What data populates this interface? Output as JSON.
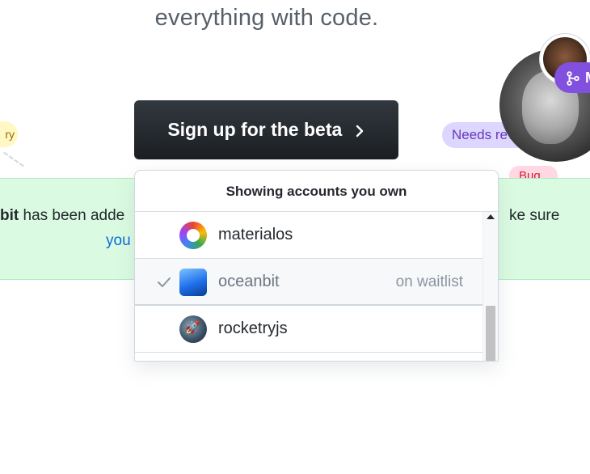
{
  "headline": "everything with code.",
  "labels": {
    "yellow_partial": "ry",
    "needs_review": "Needs review",
    "bug": "Bug"
  },
  "merge_pill": {
    "text": "M"
  },
  "cta": {
    "label": "Sign up for the beta"
  },
  "banner": {
    "org_partial": "bit",
    "text_partial": " has been adde",
    "right_partial": "ke sure",
    "link_partial": "you"
  },
  "dropdown": {
    "header": "Showing accounts you own",
    "items": [
      {
        "name": "materialos",
        "status": "",
        "selected": false,
        "icon": "materialos-org-icon"
      },
      {
        "name": "oceanbit",
        "status": "on waitlist",
        "selected": true,
        "icon": "oceanbit-org-icon"
      },
      {
        "name": "rocketryjs",
        "status": "",
        "selected": false,
        "icon": "rocketryjs-org-icon"
      }
    ]
  },
  "colors": {
    "banner_bg": "#dafbe1",
    "cta_bg": "#24292f",
    "merge_purple": "#8250df",
    "review_pill": "#ddd6fe",
    "link_blue": "#0969da"
  }
}
